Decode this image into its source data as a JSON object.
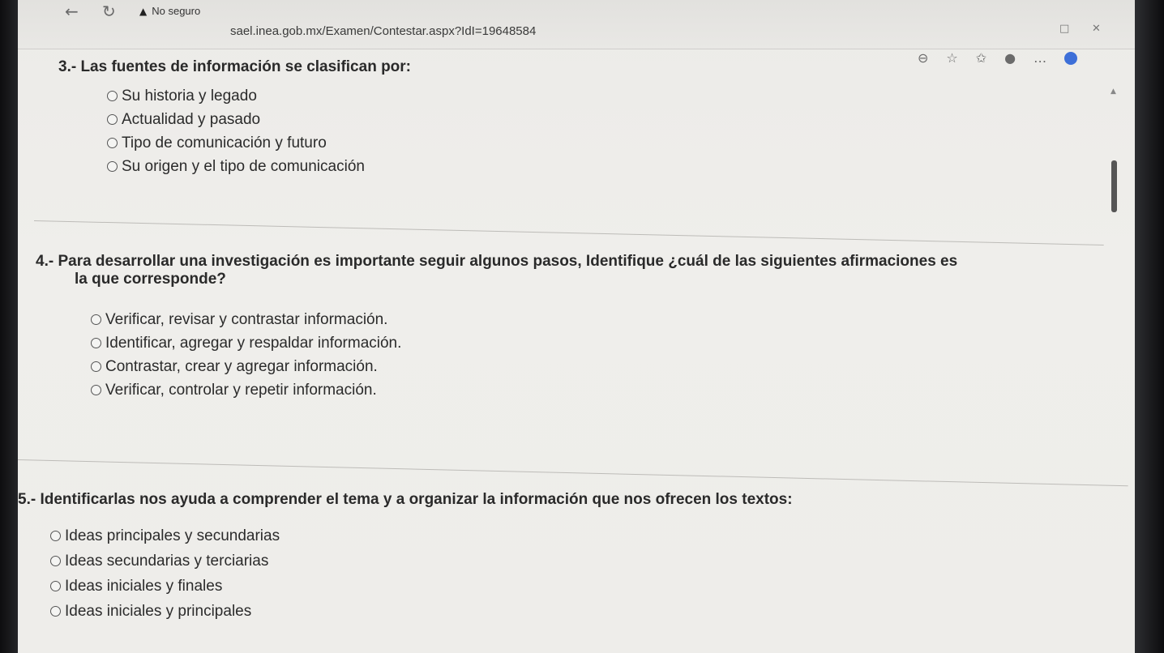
{
  "browser": {
    "security_label": "No seguro",
    "url": "sael.inea.gob.mx/Examen/Contestar.aspx?IdI=19648584",
    "icons": [
      "back-arrow-icon",
      "reload-icon",
      "warning-icon",
      "zoom-out-icon",
      "favorite-star-icon",
      "collections-icon",
      "profile-icon",
      "more-menu-icon",
      "extension-icon"
    ]
  },
  "questions": [
    {
      "title": "3.- Las fuentes de información se clasifican por:",
      "options": [
        "Su historia y legado",
        "Actualidad y pasado",
        "Tipo de comunicación y futuro",
        "Su origen y el tipo de comunicación"
      ]
    },
    {
      "title_line1": "4.- Para desarrollar una investigación es importante seguir algunos pasos, Identifique ¿cuál de las siguientes afirmaciones es",
      "title_line2": "la que corresponde?",
      "options": [
        "Verificar, revisar y contrastar información.",
        "Identificar, agregar y respaldar información.",
        "Contrastar, crear y agregar información.",
        "Verificar, controlar y repetir información."
      ]
    },
    {
      "title": "5.- Identificarlas nos ayuda a comprender el tema y a organizar la información que nos ofrecen los textos:",
      "options": [
        "Ideas principales y secundarias",
        "Ideas secundarias y terciarias",
        "Ideas iniciales y finales",
        "Ideas iniciales y principales"
      ]
    }
  ]
}
